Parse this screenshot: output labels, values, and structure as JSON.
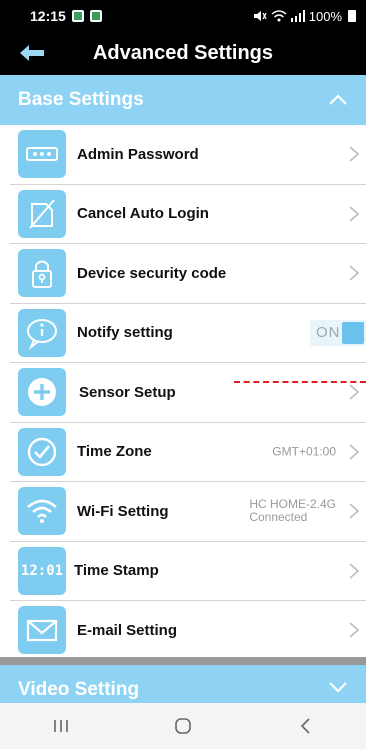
{
  "status_bar": {
    "time": "12:15",
    "right_text": "100%"
  },
  "header": {
    "title": "Advanced Settings"
  },
  "sections": {
    "base": {
      "label": "Base Settings"
    },
    "video": {
      "label": "Video Setting"
    }
  },
  "rows": [
    {
      "label": "Admin Password",
      "icon": "password-dots-icon"
    },
    {
      "label": "Cancel Auto Login",
      "icon": "cancel-login-icon"
    },
    {
      "label": "Device security code",
      "icon": "lock-icon"
    },
    {
      "label": "Notify setting",
      "icon": "info-bubble-icon",
      "toggle": "ON"
    },
    {
      "label": "Sensor Setup",
      "icon": "plus-circle-icon"
    },
    {
      "label": "Time Zone",
      "icon": "clock-check-icon",
      "value": "GMT+01:00"
    },
    {
      "label": "Wi-Fi Setting",
      "icon": "wifi-icon",
      "value_line1": "HC HOME-2.4G",
      "value_line2": "Connected"
    },
    {
      "label": "Time Stamp",
      "icon": "digital-clock-icon",
      "icon_text": "12:01"
    },
    {
      "label": "E-mail Setting",
      "icon": "envelope-icon"
    }
  ],
  "colors": {
    "accent": "#8fd3f4",
    "icon_bg": "#7ecdf0",
    "toggle_knob": "#69c3ec"
  }
}
